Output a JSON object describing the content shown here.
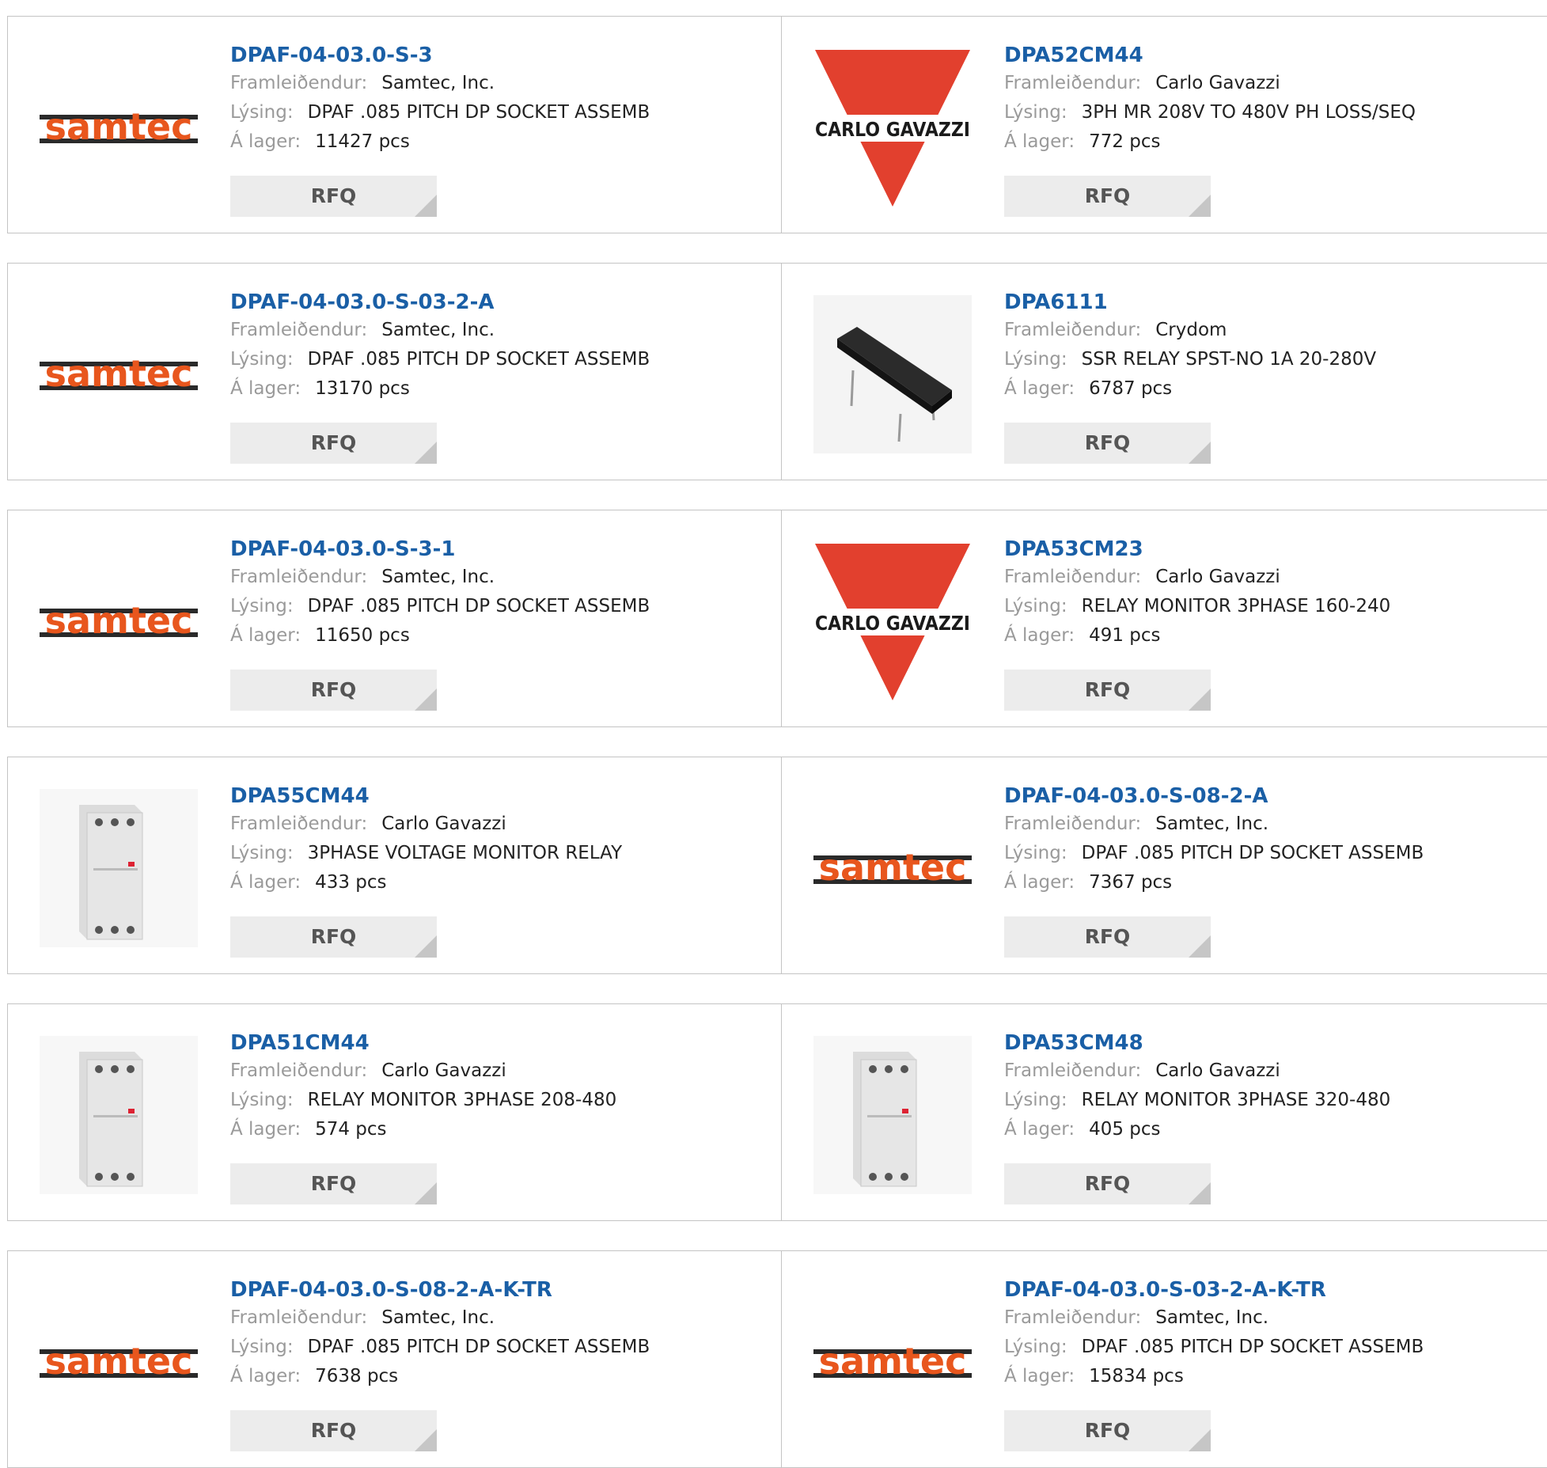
{
  "labels": {
    "manufacturer": "Framleiðendur:",
    "description": "Lýsing:",
    "stock": "Á lager:",
    "rfq": "RFQ"
  },
  "logos": {
    "samtec": "samtec",
    "carlo_gavazzi": "CARLO GAVAZZI"
  },
  "colors": {
    "part_number": "#1a5fa6",
    "label": "#9a9a9a",
    "samtec_orange": "#e8561d",
    "gavazzi_red": "#e2402e"
  },
  "products": [
    {
      "part_number": "DPAF-04-03.0-S-3",
      "manufacturer": "Samtec, Inc.",
      "description": "DPAF .085 PITCH DP SOCKET ASSEMB",
      "stock": "11427 pcs",
      "image": "samtec-logo"
    },
    {
      "part_number": "DPA52CM44",
      "manufacturer": "Carlo Gavazzi",
      "description": "3PH MR 208V TO 480V PH LOSS/SEQ",
      "stock": "772 pcs",
      "image": "carlo-gavazzi-logo"
    },
    {
      "part_number": "DPAF-04-03.0-S-03-2-A",
      "manufacturer": "Samtec, Inc.",
      "description": "DPAF .085 PITCH DP SOCKET ASSEMB",
      "stock": "13170 pcs",
      "image": "samtec-logo"
    },
    {
      "part_number": "DPA6111",
      "manufacturer": "Crydom",
      "description": "SSR RELAY SPST-NO 1A 20-280V",
      "stock": "6787 pcs",
      "image": "relay-photo"
    },
    {
      "part_number": "DPAF-04-03.0-S-3-1",
      "manufacturer": "Samtec, Inc.",
      "description": "DPAF .085 PITCH DP SOCKET ASSEMB",
      "stock": "11650 pcs",
      "image": "samtec-logo"
    },
    {
      "part_number": "DPA53CM23",
      "manufacturer": "Carlo Gavazzi",
      "description": "RELAY MONITOR 3PHASE 160-240",
      "stock": "491 pcs",
      "image": "carlo-gavazzi-logo"
    },
    {
      "part_number": "DPA55CM44",
      "manufacturer": "Carlo Gavazzi",
      "description": "3PHASE VOLTAGE MONITOR RELAY",
      "stock": "433 pcs",
      "image": "din-module-photo"
    },
    {
      "part_number": "DPAF-04-03.0-S-08-2-A",
      "manufacturer": "Samtec, Inc.",
      "description": "DPAF .085 PITCH DP SOCKET ASSEMB",
      "stock": "7367 pcs",
      "image": "samtec-logo"
    },
    {
      "part_number": "DPA51CM44",
      "manufacturer": "Carlo Gavazzi",
      "description": "RELAY MONITOR 3PHASE 208-480",
      "stock": "574 pcs",
      "image": "din-module-photo"
    },
    {
      "part_number": "DPA53CM48",
      "manufacturer": "Carlo Gavazzi",
      "description": "RELAY MONITOR 3PHASE 320-480",
      "stock": "405 pcs",
      "image": "din-module-photo"
    },
    {
      "part_number": "DPAF-04-03.0-S-08-2-A-K-TR",
      "manufacturer": "Samtec, Inc.",
      "description": "DPAF .085 PITCH DP SOCKET ASSEMB",
      "stock": "7638 pcs",
      "image": "samtec-logo"
    },
    {
      "part_number": "DPAF-04-03.0-S-03-2-A-K-TR",
      "manufacturer": "Samtec, Inc.",
      "description": "DPAF .085 PITCH DP SOCKET ASSEMB",
      "stock": "15834 pcs",
      "image": "samtec-logo"
    }
  ]
}
